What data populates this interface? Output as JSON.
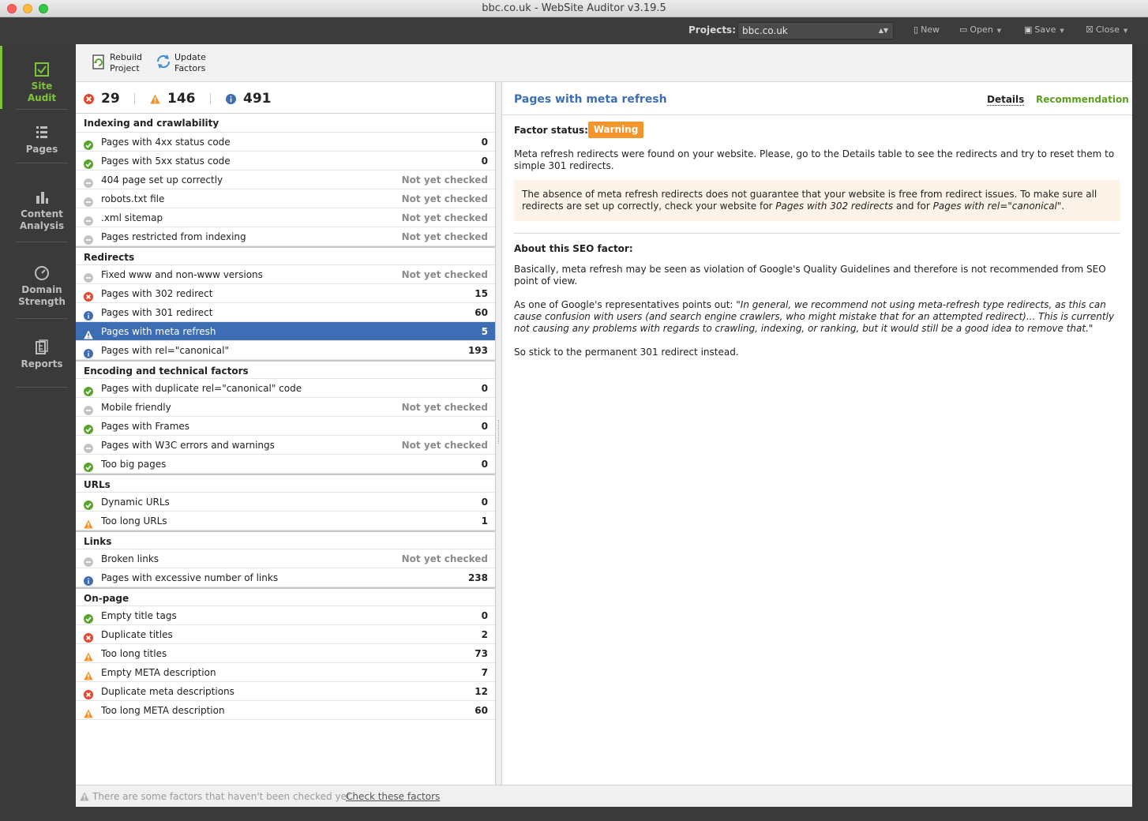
{
  "window": {
    "title": "bbc.co.uk - WebSite Auditor v3.19.5"
  },
  "topbar": {
    "projects_label": "Projects:",
    "project_value": "bbc.co.uk",
    "new_label": "New",
    "open_label": "Open",
    "save_label": "Save",
    "close_label": "Close"
  },
  "sidebar": {
    "items": [
      {
        "label": "Site Audit",
        "icon": "checkbox-icon",
        "active": true
      },
      {
        "label": "Pages",
        "icon": "pages-icon"
      },
      {
        "label": "Content Analysis",
        "icon": "content-analysis-icon"
      },
      {
        "label": "Domain Strength",
        "icon": "gauge-icon"
      },
      {
        "label": "Reports",
        "icon": "reports-icon"
      }
    ]
  },
  "toolbar": {
    "rebuild_line1": "Rebuild",
    "rebuild_line2": "Project",
    "update_line1": "Update",
    "update_line2": "Factors"
  },
  "summary": {
    "errors": "29",
    "warnings": "146",
    "info": "491"
  },
  "groups": [
    {
      "title": "Indexing and crawlability",
      "rows": [
        {
          "status": "ok",
          "label": "Pages with 4xx status code",
          "value": "0"
        },
        {
          "status": "ok",
          "label": "Pages with 5xx status code",
          "value": "0"
        },
        {
          "status": "none",
          "label": "404 page set up correctly",
          "value": "Not yet checked"
        },
        {
          "status": "none",
          "label": "robots.txt file",
          "value": "Not yet checked"
        },
        {
          "status": "none",
          "label": ".xml sitemap",
          "value": "Not yet checked"
        },
        {
          "status": "none",
          "label": "Pages restricted from indexing",
          "value": "Not yet checked"
        }
      ]
    },
    {
      "title": "Redirects",
      "rows": [
        {
          "status": "none",
          "label": "Fixed www and non-www versions",
          "value": "Not yet checked"
        },
        {
          "status": "error",
          "label": "Pages with 302 redirect",
          "value": "15"
        },
        {
          "status": "info",
          "label": "Pages with 301 redirect",
          "value": "60"
        },
        {
          "status": "warning",
          "label": "Pages with meta refresh",
          "value": "5",
          "selected": true
        },
        {
          "status": "info",
          "label": "Pages with rel=\"canonical\"",
          "value": "193"
        }
      ]
    },
    {
      "title": "Encoding and technical factors",
      "rows": [
        {
          "status": "ok",
          "label": "Pages with duplicate rel=\"canonical\" code",
          "value": "0"
        },
        {
          "status": "none",
          "label": "Mobile friendly",
          "value": "Not yet checked"
        },
        {
          "status": "ok",
          "label": "Pages with Frames",
          "value": "0"
        },
        {
          "status": "none",
          "label": "Pages with W3C errors and warnings",
          "value": "Not yet checked"
        },
        {
          "status": "ok",
          "label": "Too big pages",
          "value": "0"
        }
      ]
    },
    {
      "title": "URLs",
      "rows": [
        {
          "status": "ok",
          "label": "Dynamic URLs",
          "value": "0"
        },
        {
          "status": "warning",
          "label": "Too long URLs",
          "value": "1"
        }
      ]
    },
    {
      "title": "Links",
      "rows": [
        {
          "status": "none",
          "label": "Broken links",
          "value": "Not yet checked"
        },
        {
          "status": "info",
          "label": "Pages with excessive number of links",
          "value": "238"
        }
      ]
    },
    {
      "title": "On-page",
      "rows": [
        {
          "status": "ok",
          "label": "Empty title tags",
          "value": "0"
        },
        {
          "status": "error",
          "label": "Duplicate titles",
          "value": "2"
        },
        {
          "status": "warning",
          "label": "Too long titles",
          "value": "73"
        },
        {
          "status": "warning",
          "label": "Empty META description",
          "value": "7"
        },
        {
          "status": "error",
          "label": "Duplicate meta descriptions",
          "value": "12"
        },
        {
          "status": "warning",
          "label": "Too long META description",
          "value": "60"
        }
      ]
    }
  ],
  "detail": {
    "title": "Pages with meta refresh",
    "tab_details": "Details",
    "tab_recommendation": "Recommendation",
    "factor_status_label": "Factor status:",
    "factor_status_value": "Warning",
    "intro": "Meta refresh redirects were found on your website. Please, go to the Details table to see the redirects and try to reset them to simple 301 redirects.",
    "note_part1": "The absence of meta refresh redirects does not guarantee that your website is free from redirect issues. To make sure all redirects are set up correctly, check your website for ",
    "note_em1": "Pages with 302 redirects",
    "note_part2": " and for ",
    "note_em2": "Pages with rel=\"canonical\"",
    "note_part3": ".",
    "about_title": "About this SEO factor:",
    "about_p1": "Basically, meta refresh may be seen as violation of Google's Quality Guidelines and therefore is not recommended from SEO point of view.",
    "about_p2_lead": "As one of Google's representatives points out: ",
    "about_p2_quote": "\"In general, we recommend not using meta-refresh type redirects, as this can cause confusion with users (and search engine crawlers, who might mistake that for an attempted redirect)... This is currently not causing any problems with regards to crawling, indexing, or ranking, but it would still be a good idea to remove that.\"",
    "about_p3": "So stick to the permanent 301 redirect instead."
  },
  "statusbar": {
    "message": "There are some factors that haven't been checked yet.",
    "link": "Check these factors"
  },
  "colors": {
    "accent": "#7ec43a",
    "selection": "#3d6eb4",
    "warning": "#f4952b",
    "error": "#e0462e",
    "info": "#3d6eb4",
    "ok": "#5aa532"
  }
}
